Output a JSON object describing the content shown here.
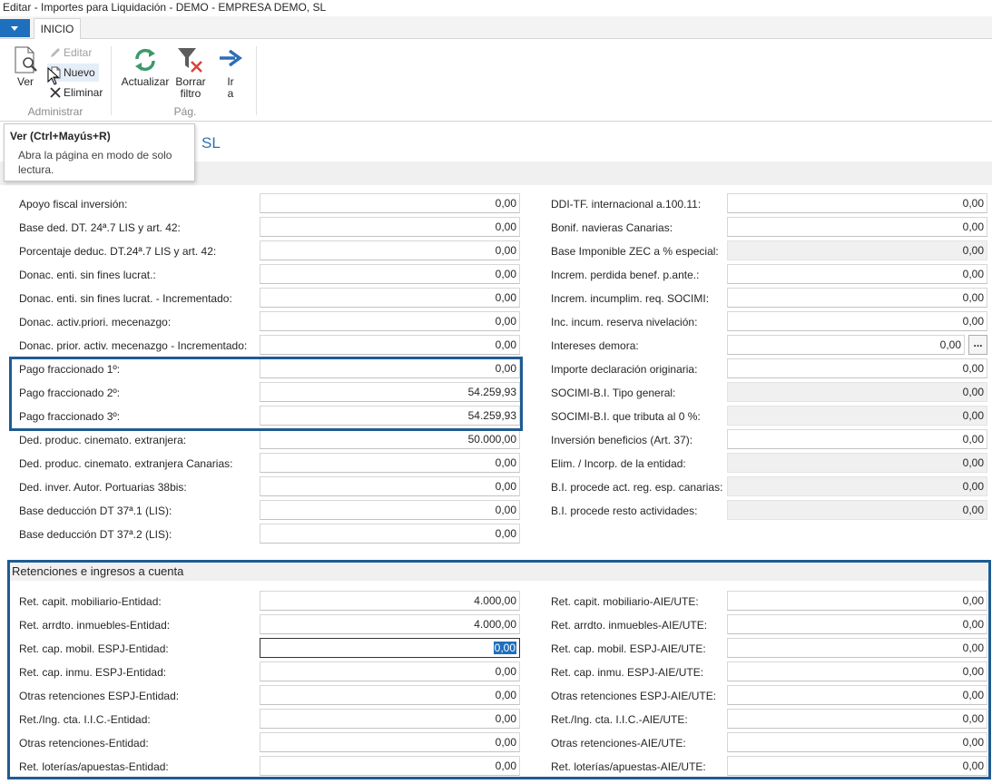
{
  "window": {
    "title": "Editar - Importes para Liquidación - DEMO - EMPRESA DEMO, SL"
  },
  "tabs": [
    {
      "label": "INICIO"
    }
  ],
  "ribbon": {
    "ver": "Ver",
    "editar": "Editar",
    "nuevo": "Nuevo",
    "eliminar": "Eliminar",
    "group_administrar": "Administrar",
    "actualizar": "Actualizar",
    "borrar_filtro_1": "Borrar",
    "borrar_filtro_2": "filtro",
    "ir_a_1": "Ir",
    "ir_a_2": "a",
    "group_pag": "Pág."
  },
  "tooltip": {
    "title": "Ver (Ctrl+Mayús+R)",
    "body_1": "Abra la página en modo de solo",
    "body_2": "lectura."
  },
  "page_title_visible": "SL",
  "general_left": [
    {
      "label": "Apoyo fiscal inversión:",
      "value": "0,00"
    },
    {
      "label": "Base ded. DT. 24ª.7 LIS y art. 42:",
      "value": "0,00"
    },
    {
      "label": "Porcentaje deduc. DT.24ª.7 LIS y art. 42:",
      "value": "0,00"
    },
    {
      "label": "Donac. enti. sin fines lucrat.:",
      "value": "0,00"
    },
    {
      "label": "Donac. enti. sin fines lucrat. - Incrementado:",
      "value": "0,00"
    },
    {
      "label": "Donac. activ.priori. mecenazgo:",
      "value": "0,00"
    },
    {
      "label": "Donac. prior. activ. mecenazgo - Incrementado:",
      "value": "0,00"
    },
    {
      "label": "Pago fraccionado 1º:",
      "value": "0,00"
    },
    {
      "label": "Pago fraccionado 2º:",
      "value": "54.259,93"
    },
    {
      "label": "Pago fraccionado 3º:",
      "value": "54.259,93"
    },
    {
      "label": "Ded. produc. cinemato. extranjera:",
      "value": "50.000,00"
    },
    {
      "label": "Ded. produc. cinemato. extranjera Canarias:",
      "value": "0,00"
    },
    {
      "label": "Ded. inver. Autor. Portuarias 38bis:",
      "value": "0,00"
    },
    {
      "label": "Base deducción DT 37ª.1 (LIS):",
      "value": "0,00"
    },
    {
      "label": "Base deducción DT 37ª.2 (LIS):",
      "value": "0,00"
    }
  ],
  "general_right": [
    {
      "label": "DDI-TF. internacional a.100.11:",
      "value": "0,00"
    },
    {
      "label": "Bonif. navieras Canarias:",
      "value": "0,00"
    },
    {
      "label": "Base Imponible ZEC a % especial:",
      "value": "0,00"
    },
    {
      "label": "Increm. perdida benef. p.ante.:",
      "value": "0,00"
    },
    {
      "label": "Increm. incumplim. req. SOCIMI:",
      "value": "0,00"
    },
    {
      "label": "Inc. incum. reserva nivelación:",
      "value": "0,00"
    },
    {
      "label": "Intereses demora:",
      "value": "0,00"
    },
    {
      "label": "Importe declaración originaria:",
      "value": "0,00"
    },
    {
      "label": "SOCIMI-B.I. Tipo general:",
      "value": "0,00"
    },
    {
      "label": "SOCIMI-B.I. que tributa al 0 %:",
      "value": "0,00"
    },
    {
      "label": "Inversión beneficios (Art. 37):",
      "value": "0,00"
    },
    {
      "label": "Elim. / Incorp. de la entidad:",
      "value": "0,00"
    },
    {
      "label": "B.I. procede act. reg. esp. canarias:",
      "value": "0,00"
    },
    {
      "label": "B.I. procede resto actividades:",
      "value": "0,00"
    }
  ],
  "lookup_button": "...",
  "retenciones": {
    "title": "Retenciones e ingresos a cuenta",
    "left": [
      {
        "label": "Ret. capit. mobiliario-Entidad:",
        "value": "4.000,00"
      },
      {
        "label": "Ret. arrdto. inmuebles-Entidad:",
        "value": "4.000,00"
      },
      {
        "label": "Ret. cap. mobil. ESPJ-Entidad:",
        "value": "0,00"
      },
      {
        "label": "Ret. cap. inmu. ESPJ-Entidad:",
        "value": "0,00"
      },
      {
        "label": "Otras retenciones ESPJ-Entidad:",
        "value": "0,00"
      },
      {
        "label": "Ret./Ing. cta. I.I.C.-Entidad:",
        "value": "0,00"
      },
      {
        "label": "Otras retenciones-Entidad:",
        "value": "0,00"
      },
      {
        "label": "Ret. loterías/apuestas-Entidad:",
        "value": "0,00"
      }
    ],
    "right": [
      {
        "label": "Ret. capit. mobiliario-AIE/UTE:",
        "value": "0,00"
      },
      {
        "label": "Ret. arrdto. inmuebles-AIE/UTE:",
        "value": "0,00"
      },
      {
        "label": "Ret. cap. mobil. ESPJ-AIE/UTE:",
        "value": "0,00"
      },
      {
        "label": "Ret. cap. inmu. ESPJ-AIE/UTE:",
        "value": "0,00"
      },
      {
        "label": "Otras retenciones ESPJ-AIE/UTE:",
        "value": "0,00"
      },
      {
        "label": "Ret./Ing. cta. I.I.C.-AIE/UTE:",
        "value": "0,00"
      },
      {
        "label": "Otras retenciones-AIE/UTE:",
        "value": "0,00"
      },
      {
        "label": "Ret. loterías/apuestas-AIE/UTE:",
        "value": "0,00"
      }
    ]
  },
  "colors": {
    "accent": "#1e6fbd",
    "highlight_border": "#1f5b93",
    "title_blue": "#2f6eb5"
  }
}
